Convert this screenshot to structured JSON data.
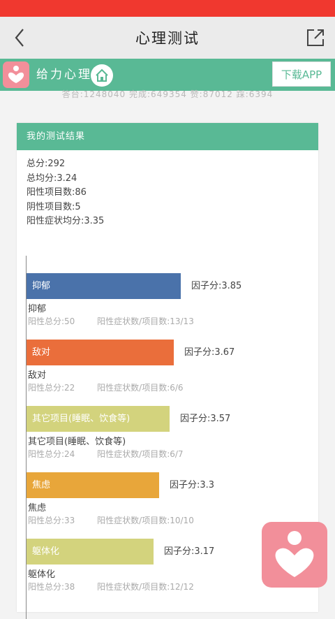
{
  "nav": {
    "title": "心理测试"
  },
  "banner": {
    "app_name": "给力心理",
    "download_label": "下载APP"
  },
  "stats_line": "答台:1248040  完成:649354  赞:87012  踩:6394",
  "result": {
    "header": "我的测试结果",
    "summary": [
      "总分:292",
      "总均分:3.24",
      "阳性项目数:86",
      "阴性项目数:5",
      "阳性症状均分:3.35"
    ],
    "factors": [
      {
        "label": "抑郁",
        "score_text": "因子分:3.85",
        "score": 3.85,
        "name": "抑郁",
        "positive_total": "阳性总分:50",
        "symptom_ratio": "阳性症状数/项目数:13/13",
        "color": "#4a72aa"
      },
      {
        "label": "敌对",
        "score_text": "因子分:3.67",
        "score": 3.67,
        "name": "敌对",
        "positive_total": "阳性总分:22",
        "symptom_ratio": "阳性症状数/项目数:6/6",
        "color": "#ea6e3b"
      },
      {
        "label": "其它项目(睡眠、饮食等)",
        "score_text": "因子分:3.57",
        "score": 3.57,
        "name": "其它项目(睡眠、饮食等)",
        "positive_total": "阳性总分:24",
        "symptom_ratio": "阳性症状数/项目数:6/7",
        "color": "#d3d37d"
      },
      {
        "label": "焦虑",
        "score_text": "因子分:3.3",
        "score": 3.3,
        "name": "焦虑",
        "positive_total": "阳性总分:33",
        "symptom_ratio": "阳性症状数/项目数:10/10",
        "color": "#e8a63a"
      },
      {
        "label": "躯体化",
        "score_text": "因子分:3.17",
        "score": 3.17,
        "name": "躯体化",
        "positive_total": "阳性总分:38",
        "symptom_ratio": "阳性症状数/项目数:12/12",
        "color": "#d3d37d"
      }
    ]
  }
}
